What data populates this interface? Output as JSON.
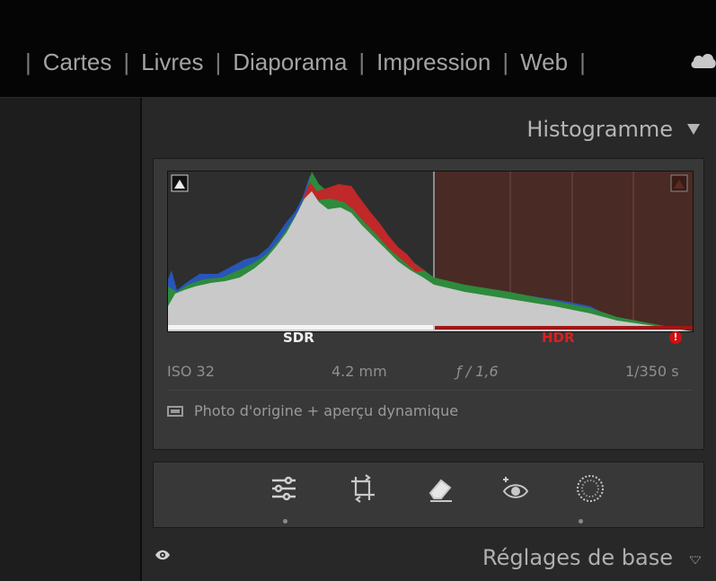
{
  "topbar": {
    "modules": [
      "Cartes",
      "Livres",
      "Diaporama",
      "Impression",
      "Web"
    ]
  },
  "histogram": {
    "title": "Histogramme",
    "sdr_label": "SDR",
    "hdr_label": "HDR",
    "hdr_warning": "!",
    "exif": {
      "iso": "ISO 32",
      "focal": "4.2 mm",
      "aperture": "ƒ / 1,6",
      "shutter": "1/350 s"
    },
    "preview_mode": "Photo d'origine + aperçu dynamique"
  },
  "tools": [
    "sliders-icon",
    "crop-icon",
    "eraser-icon",
    "redeye-icon",
    "mask-icon"
  ],
  "basic_panel": {
    "title": "Réglages de base"
  },
  "colors": {
    "sdr": "#f4f4f4",
    "hdr": "#d92020",
    "hdr_region": "#4a2a24"
  }
}
